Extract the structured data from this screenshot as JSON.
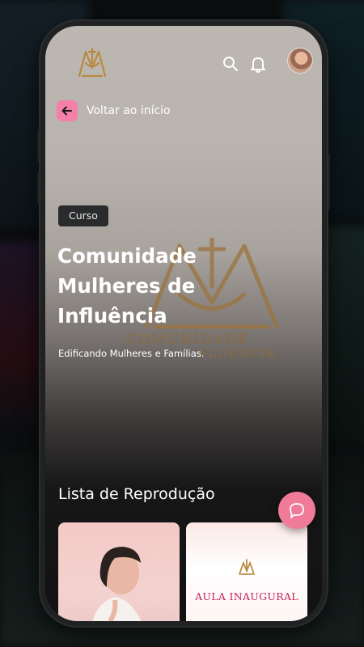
{
  "app": {
    "brand": "Comunidade Mulheres de Influência"
  },
  "header": {
    "search_icon": "search-icon",
    "bell_icon": "bell-icon",
    "avatar": "user-avatar"
  },
  "nav": {
    "back_label": "Voltar ao início"
  },
  "hero": {
    "badge": "Curso",
    "title": "Comunidade Mulheres de Influência",
    "subtitle": "Edificando Mulheres e Famílias.",
    "watermark_line1": "COMUNIDADE",
    "watermark_line2": "FLUÊNCIA"
  },
  "playlist": {
    "heading": "Lista de Reprodução",
    "cards": [
      {
        "text": ""
      },
      {
        "text": "AULA INAUGURAL"
      }
    ]
  },
  "chat_button": "chat-icon",
  "colors": {
    "accent_pink": "#f47fa8",
    "gold": "#b8893f",
    "badge_bg": "#2a2b2c"
  }
}
